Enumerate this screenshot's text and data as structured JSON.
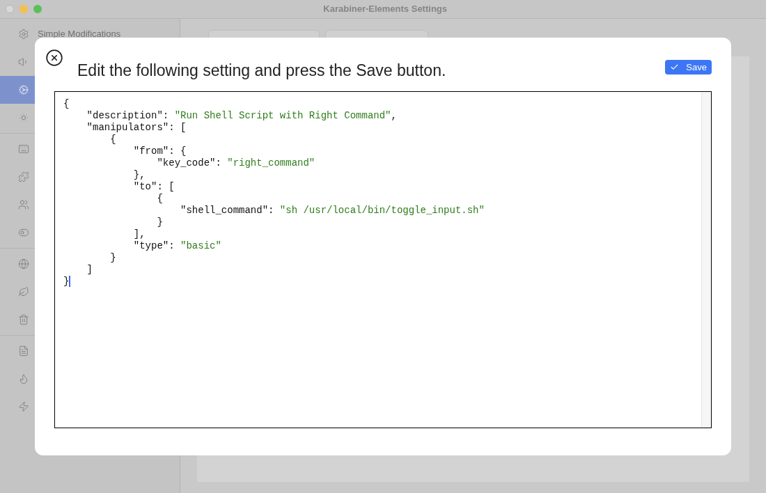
{
  "window": {
    "title": "Karabiner-Elements Settings"
  },
  "sidebar": {
    "groups": [
      [
        {
          "label": "Simple Modifications",
          "selected": false
        },
        {
          "selected": false
        },
        {
          "selected": true
        },
        {
          "selected": false
        }
      ],
      [
        {
          "selected": false
        },
        {
          "selected": false
        },
        {
          "selected": false
        },
        {
          "selected": false
        }
      ],
      [
        {
          "selected": false
        },
        {
          "selected": false
        },
        {
          "selected": false
        }
      ],
      [
        {
          "selected": false
        },
        {
          "selected": false
        },
        {
          "selected": false
        }
      ]
    ]
  },
  "dialog": {
    "heading": "Edit the following setting and press the Save button.",
    "save_button": "Save",
    "editor": {
      "lines": [
        {
          "code": "{",
          "caret": false
        },
        {
          "code": "    \"description\": ",
          "string": "\"Run Shell Script with Right Command\"",
          "tail": ",",
          "caret": false
        },
        {
          "code": "    \"manipulators\": [",
          "caret": false
        },
        {
          "code": "        {",
          "caret": false
        },
        {
          "code": "            \"from\": {",
          "caret": false
        },
        {
          "code": "                \"key_code\": ",
          "string": "\"right_command\"",
          "caret": false
        },
        {
          "code": "            },",
          "caret": false
        },
        {
          "code": "            \"to\": [",
          "caret": false
        },
        {
          "code": "                {",
          "caret": false
        },
        {
          "code": "                    \"shell_command\": ",
          "string": "\"sh /usr/local/bin/toggle_input.sh\"",
          "caret": false
        },
        {
          "code": "                }",
          "caret": false
        },
        {
          "code": "            ],",
          "caret": false
        },
        {
          "code": "            \"type\": ",
          "string": "\"basic\"",
          "caret": false
        },
        {
          "code": "        }",
          "caret": false
        },
        {
          "code": "    ]",
          "caret": false
        },
        {
          "code": "}",
          "caret": true
        }
      ]
    }
  }
}
